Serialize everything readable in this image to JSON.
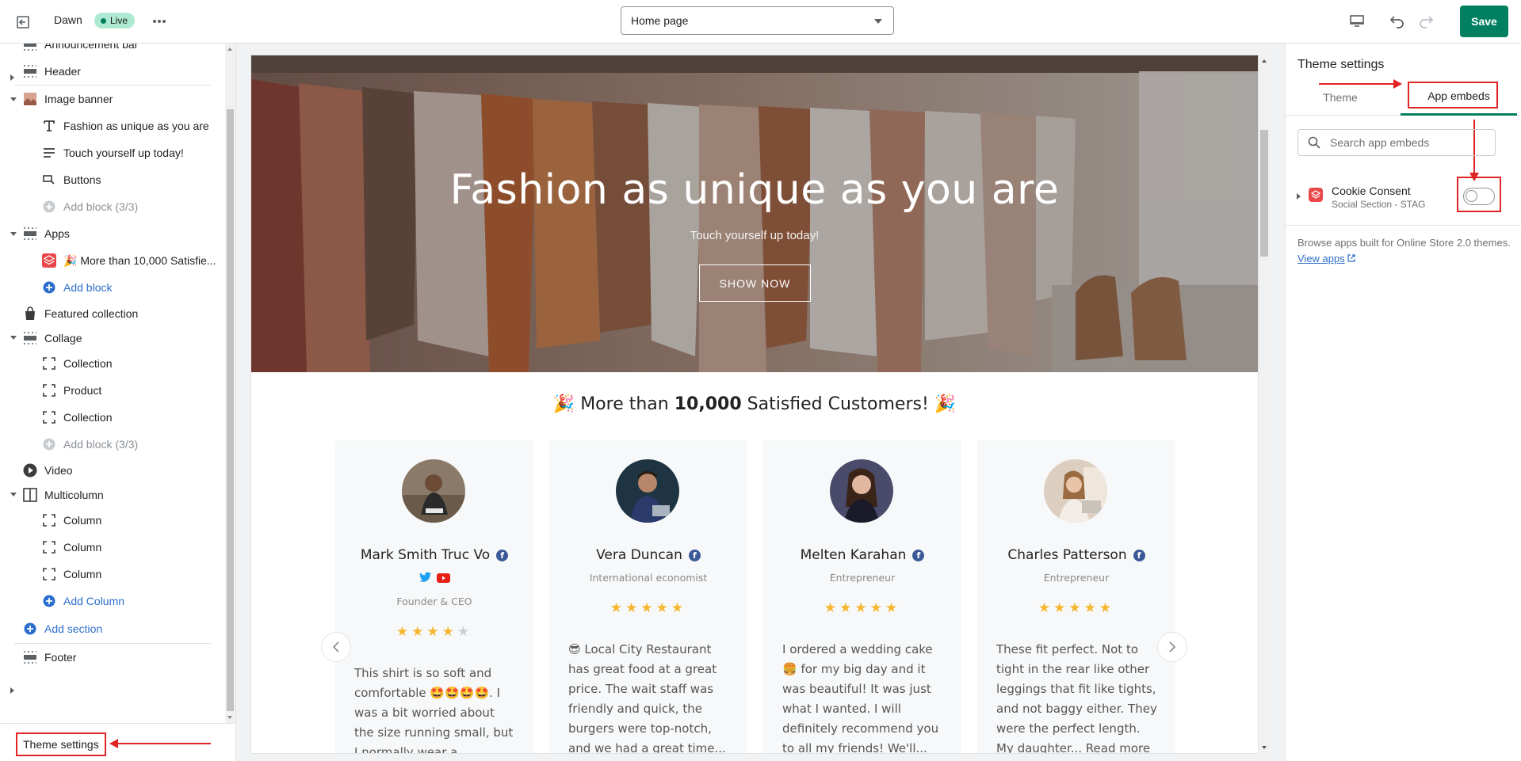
{
  "topbar": {
    "theme_name": "Dawn",
    "status_badge": "Live",
    "page_select_value": "Home page",
    "save_label": "Save"
  },
  "sidebar": {
    "items": [
      {
        "label": "Announcement bar",
        "kind": "section",
        "arrow": "right",
        "icon": "section-icon"
      },
      {
        "label": "Header",
        "kind": "section",
        "arrow": "",
        "icon": "section-icon"
      },
      {
        "label": "Image banner",
        "kind": "section",
        "arrow": "down",
        "icon": "image-icon"
      },
      {
        "label": "Fashion as unique as you are",
        "kind": "block",
        "icon": "text-icon"
      },
      {
        "label": "Touch yourself up today!",
        "kind": "block",
        "icon": "paragraph-icon"
      },
      {
        "label": "Buttons",
        "kind": "block",
        "icon": "buttons-icon"
      },
      {
        "label": "Add block (3/3)",
        "kind": "add-disabled",
        "icon": "plus-circle-icon"
      },
      {
        "label": "Apps",
        "kind": "section",
        "arrow": "down",
        "icon": "section-icon"
      },
      {
        "label": "🎉 More than 10,000 Satisfie...",
        "kind": "block",
        "icon": "app-icon"
      },
      {
        "label": "Add block",
        "kind": "add",
        "icon": "plus-circle-icon"
      },
      {
        "label": "Featured collection",
        "kind": "section",
        "arrow": "",
        "icon": "bag-icon"
      },
      {
        "label": "Collage",
        "kind": "section",
        "arrow": "down",
        "icon": "section-icon"
      },
      {
        "label": "Collection",
        "kind": "block",
        "icon": "frame-icon"
      },
      {
        "label": "Product",
        "kind": "block",
        "icon": "frame-icon"
      },
      {
        "label": "Collection",
        "kind": "block",
        "icon": "frame-icon"
      },
      {
        "label": "Add block (3/3)",
        "kind": "add-disabled",
        "icon": "plus-circle-icon"
      },
      {
        "label": "Video",
        "kind": "section",
        "arrow": "",
        "icon": "play-icon"
      },
      {
        "label": "Multicolumn",
        "kind": "section",
        "arrow": "down",
        "icon": "columns-icon"
      },
      {
        "label": "Column",
        "kind": "block",
        "icon": "frame-icon"
      },
      {
        "label": "Column",
        "kind": "block",
        "icon": "frame-icon"
      },
      {
        "label": "Column",
        "kind": "block",
        "icon": "frame-icon"
      },
      {
        "label": "Add Column",
        "kind": "add",
        "icon": "plus-circle-icon"
      },
      {
        "label": "Add section",
        "kind": "add-section",
        "icon": "plus-circle-icon"
      },
      {
        "label": "Footer",
        "kind": "section",
        "arrow": "right",
        "icon": "section-icon"
      }
    ],
    "theme_settings_label": "Theme settings"
  },
  "preview": {
    "hero_title": "Fashion as unique as you are",
    "hero_subtitle": "Touch yourself up today!",
    "hero_button": "SHOW NOW",
    "reviews_prefix": "More than ",
    "reviews_count": "10,000",
    "reviews_suffix": " Satisfied Customers!",
    "reviews_emoji": "🎉",
    "cards": [
      {
        "name": "Mark Smith Truc Vo",
        "role": "Founder & CEO",
        "rating": 4,
        "socials": [
          "twitter-icon",
          "youtube-icon"
        ],
        "text": "This shirt is so soft and comfortable 🤩🤩🤩🤩. I was a bit worried about the size running small, but I normally wear a medium..."
      },
      {
        "name": "Vera Duncan",
        "role": "International economist",
        "rating": 5,
        "text": "😎 Local City Restaurant has great food at a great price. The wait staff was friendly and quick, the burgers were top-notch, and we had a great time..."
      },
      {
        "name": "Melten Karahan",
        "role": "Entrepreneur",
        "rating": 5,
        "text": "I ordered a wedding cake 🍔 for my big day and it was beautiful! It was just what I wanted. I will definitely recommend you to all my friends! We'll..."
      },
      {
        "name": "Charles Patterson",
        "role": "Entrepreneur",
        "rating": 5,
        "text": "These fit perfect. Not to tight in the rear like other leggings that fit like tights, and not baggy either. They were the perfect length. My daughter... Read more"
      }
    ]
  },
  "right_panel": {
    "title": "Theme settings",
    "tab_theme": "Theme",
    "tab_app_embeds": "App embeds",
    "search_placeholder": "Search app embeds",
    "embed_name": "Cookie Consent",
    "embed_sub": "Social Section - STAG",
    "embed_enabled": false,
    "browse_text": "Browse apps built for Online Store 2.0 themes. ",
    "browse_link": "View apps"
  },
  "colors": {
    "primary": "#008060",
    "annotation": "#e02424",
    "link": "#2c6ecb",
    "star": "#f5b62e"
  }
}
